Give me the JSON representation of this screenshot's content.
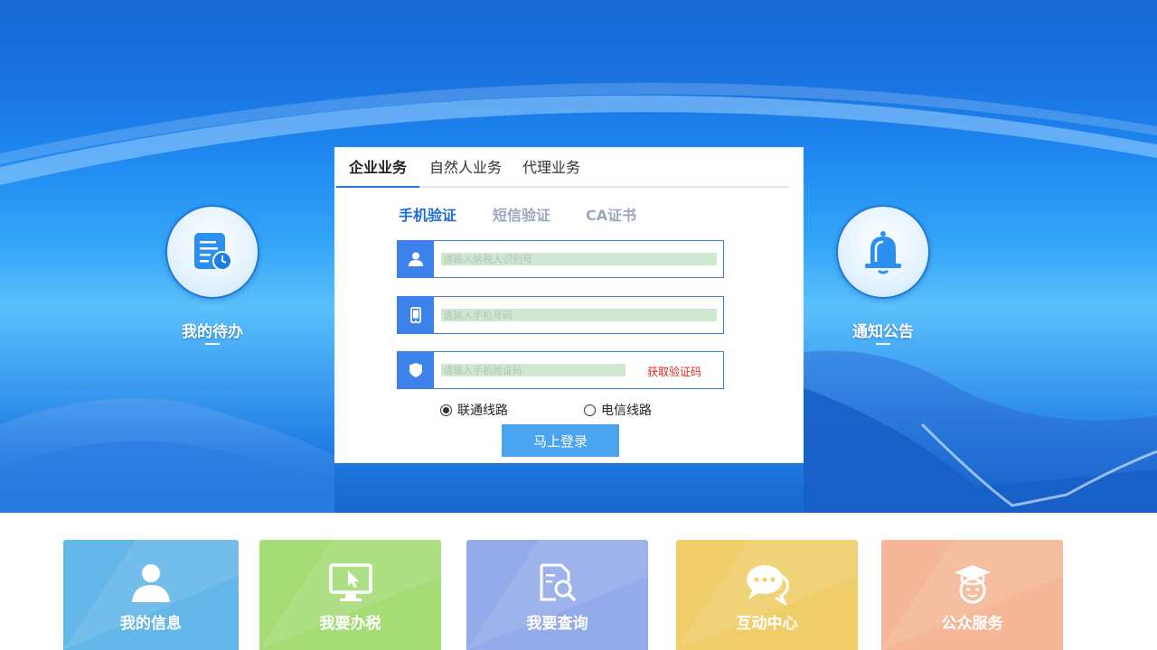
{
  "quick_links": {
    "todo": {
      "label": "我的待办"
    },
    "notice": {
      "label": "通知公告"
    }
  },
  "login": {
    "tabs": [
      "企业业务",
      "自然人业务",
      "代理业务"
    ],
    "subtabs": [
      "手机验证",
      "短信验证",
      "CA证书"
    ],
    "fields": {
      "id_placeholder": "请输入纳税人识别号",
      "phone_placeholder": "请输入手机号码",
      "code_placeholder": "请输入手机验证码",
      "get_code_label": "获取验证码"
    },
    "lines": {
      "unicom": "联通线路",
      "telecom": "电信线路",
      "selected": "联通线路"
    },
    "submit_label": "马上登录"
  },
  "services": [
    {
      "label": "我的信息",
      "color": "#63b6e8",
      "icon": "user-icon"
    },
    {
      "label": "我要办税",
      "color": "#a6dc76",
      "icon": "monitor-icon"
    },
    {
      "label": "我要查询",
      "color": "#93abea",
      "icon": "search-doc-icon"
    },
    {
      "label": "互动中心",
      "color": "#efce6a",
      "icon": "chat-icon"
    },
    {
      "label": "公众服务",
      "color": "#f5b797",
      "icon": "graduate-icon"
    }
  ],
  "colors": {
    "primary": "#1f6ed4",
    "accent_red": "#d9261c",
    "button": "#4aa4ef"
  }
}
